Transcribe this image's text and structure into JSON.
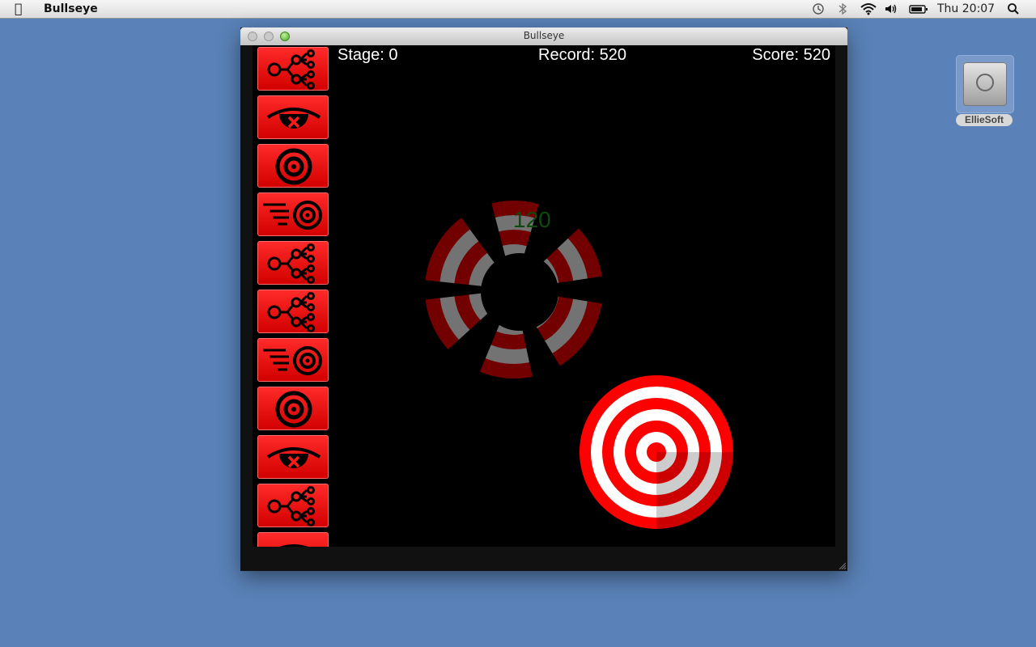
{
  "menubar": {
    "app_name": "Bullseye",
    "clock": "Thu 20:07",
    "icons": [
      "apple-icon",
      "time-machine-icon",
      "bluetooth-icon",
      "wifi-icon",
      "volume-icon",
      "battery-icon",
      "spotlight-icon"
    ]
  },
  "desktop": {
    "disk_label": "EllieSoft"
  },
  "window": {
    "title": "Bullseye"
  },
  "hud": {
    "stage": "Stage: 0",
    "record": "Record: 520",
    "score": "Score: 520"
  },
  "floating_points": "120",
  "powerups": [
    "multi-split-icon",
    "blind-eye-icon",
    "target-icon",
    "fast-target-icon",
    "multi-split-icon",
    "multi-split-icon",
    "fast-target-icon",
    "target-icon",
    "blind-eye-icon",
    "multi-split-icon",
    "blind-eye-icon"
  ],
  "colors": {
    "desktop": "#5a82b8",
    "tile_red": "#ff0000",
    "target_red": "#ff0000",
    "target_white": "#ffffff",
    "points_green": "#0d4a0d"
  }
}
